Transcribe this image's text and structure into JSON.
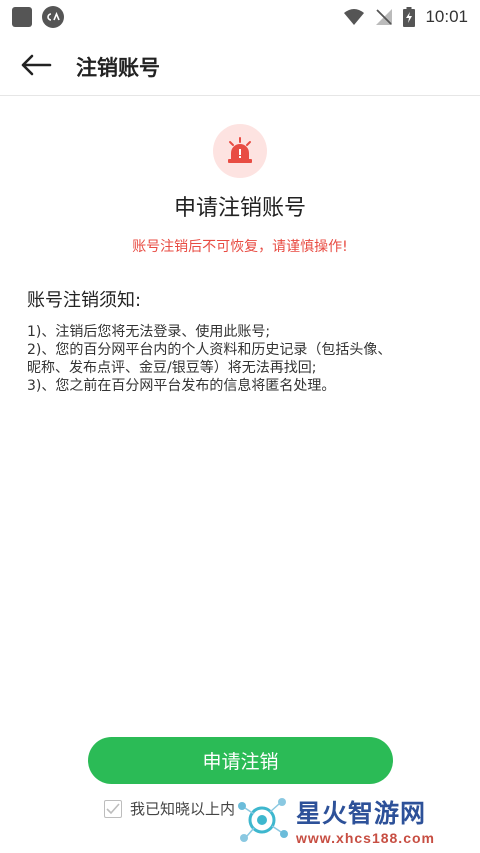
{
  "status_bar": {
    "time": "10:01",
    "icons": [
      "app-square-icon",
      "ca-app-icon",
      "wifi-icon",
      "no-signal-icon",
      "battery-charging-icon"
    ]
  },
  "app_bar": {
    "title": "注销账号",
    "back_icon": "arrow-left-icon"
  },
  "main": {
    "alarm_icon": "siren-alarm-icon",
    "heading": "申请注销账号",
    "warning": "账号注销后不可恢复，请谨慎操作!",
    "notice_title": "账号注销须知:",
    "notice_lines": [
      "1)、注销后您将无法登录、使用此账号;",
      "2)、您的百分网平台内的个人资料和历史记录（包括头像、",
      "昵称、发布点评、金豆/银豆等）将无法再找回;",
      "3)、您之前在百分网平台发布的信息将匿名处理。"
    ]
  },
  "footer": {
    "apply_label": "申请注销",
    "agree_text": "我已知晓以上内"
  },
  "watermark": {
    "name": "星火智游网",
    "url": "www.xhcs188.com"
  },
  "colors": {
    "accent_green": "#2bbb56",
    "warning_red": "#e84c43",
    "alarm_bg": "#fde3e1"
  }
}
